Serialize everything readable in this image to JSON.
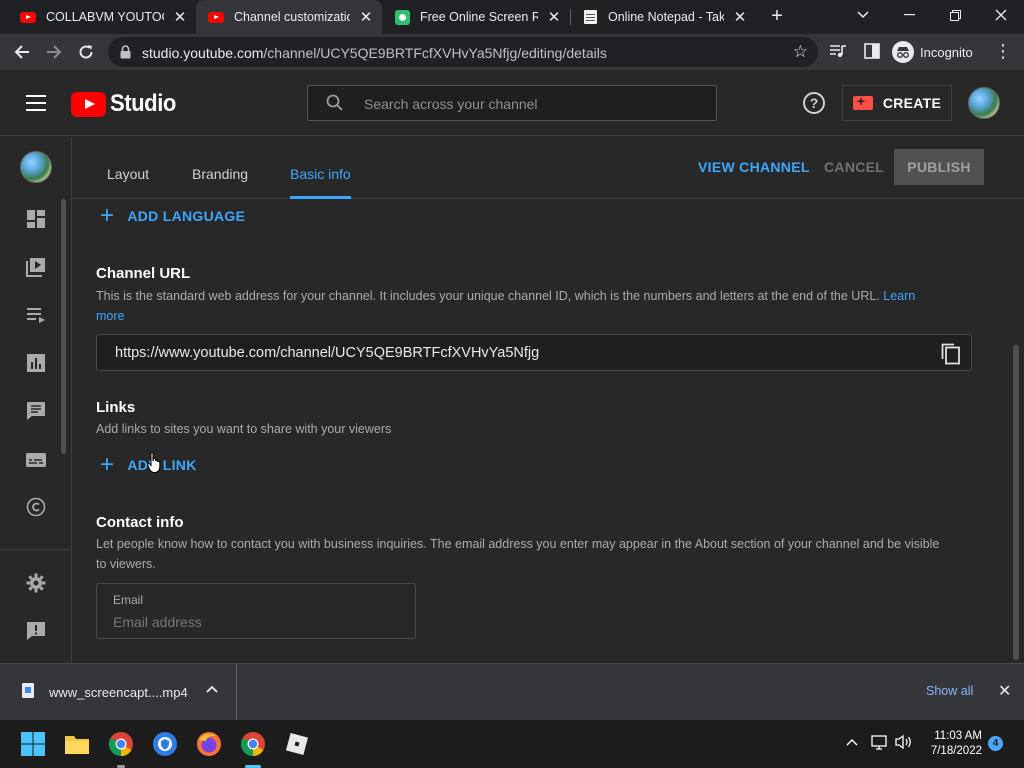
{
  "browser": {
    "tabs": [
      {
        "title": "COLLABVM YOUTOOB",
        "icon": "youtube-icon",
        "active": false
      },
      {
        "title": "Channel customization",
        "icon": "youtube-icon",
        "active": true
      },
      {
        "title": "Free Online Screen Rec",
        "icon": "screen-recorder-icon",
        "active": false
      },
      {
        "title": "Online Notepad - Take",
        "icon": "notepad-icon",
        "active": false
      }
    ],
    "url_host": "studio.youtube.com",
    "url_path": "/channel/UCY5QE9BRTFcfXVHvYa5Nfjg/editing/details",
    "incognito_label": "Incognito"
  },
  "studio": {
    "logo_text": "Studio",
    "search_placeholder": "Search across your channel",
    "create_label": "CREATE"
  },
  "tabs": [
    {
      "label": "Layout",
      "active": false
    },
    {
      "label": "Branding",
      "active": false
    },
    {
      "label": "Basic info",
      "active": true
    }
  ],
  "actions": {
    "view_channel": "VIEW CHANNEL",
    "cancel": "CANCEL",
    "publish": "PUBLISH"
  },
  "basic_info": {
    "add_language": "ADD LANGUAGE",
    "channel_url": {
      "title": "Channel URL",
      "description": "This is the standard web address for your channel. It includes your unique channel ID, which is the numbers and letters at the end of the URL.",
      "learn_more_1": "Learn",
      "learn_more_2": "more",
      "value": "https://www.youtube.com/channel/UCY5QE9BRTFcfXVHvYa5Nfjg"
    },
    "links": {
      "title": "Links",
      "description": "Add links to sites you want to share with your viewers",
      "add_link": "ADD LINK"
    },
    "contact": {
      "title": "Contact info",
      "description_1": "Let people know how to contact you with business inquiries. The email address you enter may appear in the About section of your channel and be visible",
      "description_2": "to viewers.",
      "email_label": "Email",
      "email_placeholder": "Email address",
      "email_value": ""
    }
  },
  "download_bar": {
    "filename": "www_screencapt....mp4",
    "show_all": "Show all"
  },
  "taskbar": {
    "time": "11:03 AM",
    "date": "7/18/2022",
    "notification_count": "4"
  },
  "colors": {
    "accent_blue": "#3ea6ff",
    "youtube_red": "#ff0000",
    "background": "#282828"
  }
}
